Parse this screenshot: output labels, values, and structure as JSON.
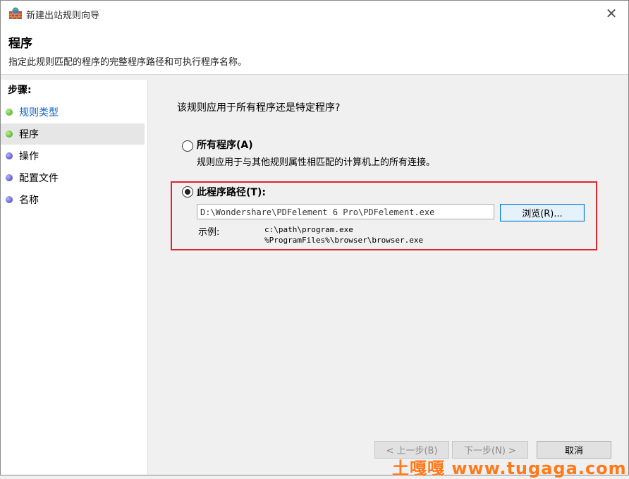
{
  "window": {
    "title": "新建出站规则向导",
    "close_glyph": "✕"
  },
  "header": {
    "title": "程序",
    "subtitle": "指定此规则匹配的程序的完整程序路径和可执行程序名称。"
  },
  "sidebar": {
    "title": "步骤:",
    "items": [
      {
        "label": "规则类型",
        "status": "done"
      },
      {
        "label": "程序",
        "status": "current"
      },
      {
        "label": "操作",
        "status": "pending"
      },
      {
        "label": "配置文件",
        "status": "pending"
      },
      {
        "label": "名称",
        "status": "pending"
      }
    ]
  },
  "main": {
    "question": "该规则应用于所有程序还是特定程序?",
    "option_all": {
      "label": "所有程序(A)",
      "description": "规则应用于与其他规则属性相匹配的计算机上的所有连接。",
      "selected": false
    },
    "option_path": {
      "label": "此程序路径(T):",
      "selected": true,
      "value": "D:\\Wondershare\\PDFelement 6 Pro\\PDFelement.exe",
      "browse_label": "浏览(R)...",
      "example_label": "示例:",
      "example_lines": [
        "c:\\path\\program.exe",
        "%ProgramFiles%\\browser\\browser.exe"
      ]
    }
  },
  "footer": {
    "back_label": "< 上一步(B)",
    "next_label": "下一步(N) >",
    "cancel_label": "取消"
  },
  "watermark": {
    "text": "土嘎嘎 www.tugaga.com"
  },
  "colors": {
    "highlight": "#e0242c",
    "link": "#0b63c6",
    "watermark": "#ff7a1a",
    "done_dot": "#3a9a16",
    "pending_dot": "#3c33b8"
  }
}
